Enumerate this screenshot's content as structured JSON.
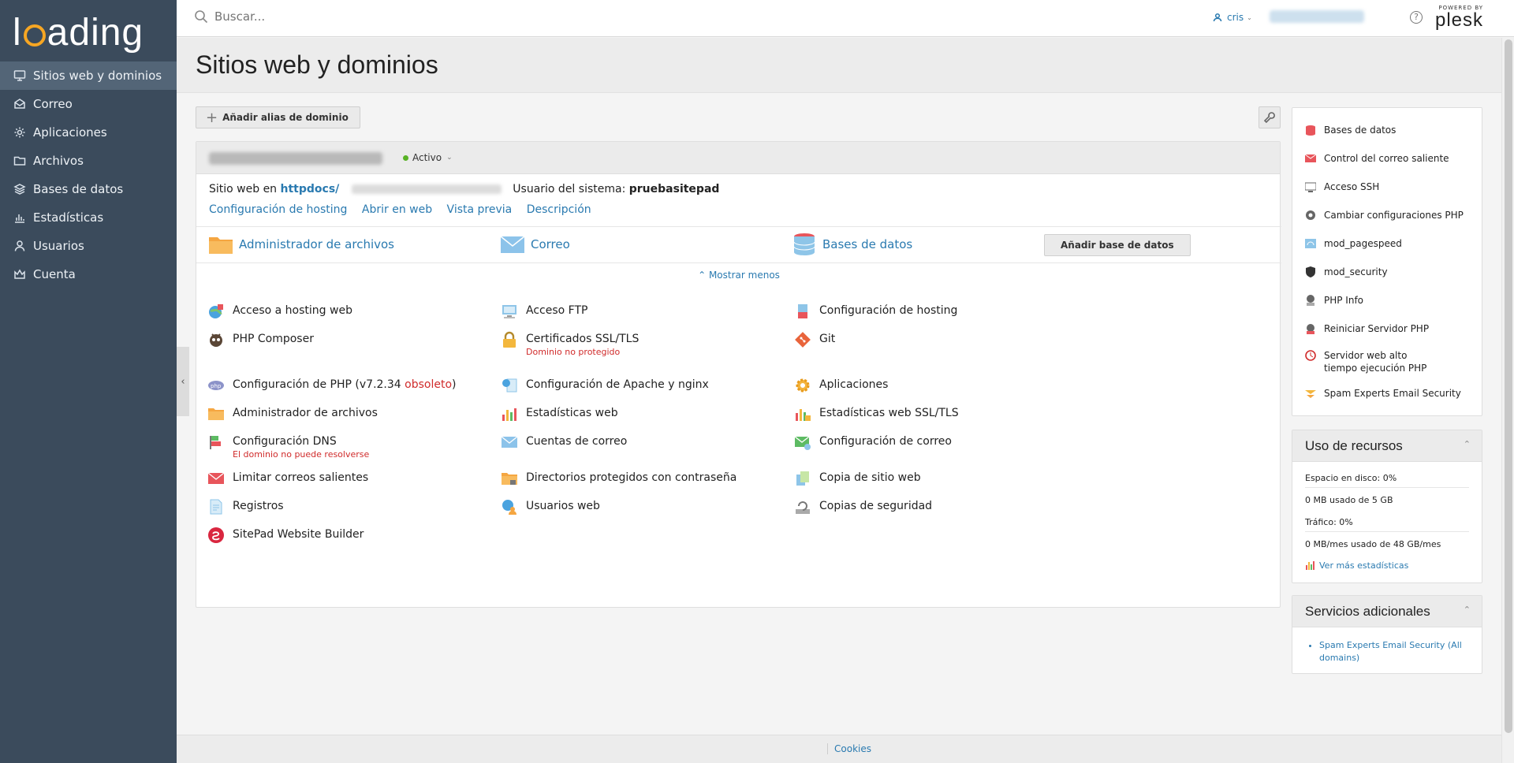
{
  "brand": {
    "logo_text_a": "l",
    "logo_text_b": "ading"
  },
  "sidebar": {
    "items": [
      {
        "label": "Sitios web y dominios",
        "icon": "monitor-icon",
        "active": true
      },
      {
        "label": "Correo",
        "icon": "envelope-icon"
      },
      {
        "label": "Aplicaciones",
        "icon": "gear-icon"
      },
      {
        "label": "Archivos",
        "icon": "folder-icon"
      },
      {
        "label": "Bases de datos",
        "icon": "layers-icon"
      },
      {
        "label": "Estadísticas",
        "icon": "bar-chart-icon"
      },
      {
        "label": "Usuarios",
        "icon": "user-icon"
      },
      {
        "label": "Cuenta",
        "icon": "crown-icon"
      }
    ]
  },
  "header": {
    "search_placeholder": "Buscar...",
    "user": "cris",
    "powered_by": "POWERED BY",
    "plesk": "plesk"
  },
  "page": {
    "title": "Sitios web y dominios"
  },
  "toolbar": {
    "add_alias": "Añadir alias de dominio"
  },
  "domain": {
    "status": "Activo",
    "site_prefix": "Sitio web en ",
    "docroot": "httpdocs/",
    "system_user_label": "Usuario del sistema: ",
    "system_user": "pruebasitepad",
    "links": [
      "Configuración de hosting",
      "Abrir en web",
      "Vista previa",
      "Descripción"
    ],
    "quick": {
      "files": "Administrador de archivos",
      "mail": "Correo",
      "databases": "Bases de datos",
      "add_db": "Añadir base de datos"
    },
    "show_less": "Mostrar menos"
  },
  "tools": {
    "web_hosting_access": "Acceso a hosting web",
    "ftp_access": "Acceso FTP",
    "hosting_settings": "Configuración de hosting",
    "php_composer": "PHP Composer",
    "ssl": "Certificados SSL/TLS",
    "ssl_warning": "Dominio no protegido",
    "git": "Git",
    "php_settings": "Configuración de PHP (v7.2.34 ",
    "php_obsolete": "obsoleto",
    "php_close": ")",
    "apache_nginx": "Configuración de Apache y nginx",
    "applications": "Aplicaciones",
    "file_manager": "Administrador de archivos",
    "web_stats": "Estadísticas web",
    "web_stats_ssl": "Estadísticas web SSL/TLS",
    "dns": "Configuración DNS",
    "dns_warning": "El dominio no puede resolverse",
    "mail_accounts": "Cuentas de correo",
    "mail_settings": "Configuración de correo",
    "limit_outgoing": "Limitar correos salientes",
    "protected_dirs": "Directorios protegidos con contraseña",
    "site_copy": "Copia de sitio web",
    "logs": "Registros",
    "web_users": "Usuarios web",
    "backups": "Copias de seguridad",
    "sitepad": "SitePad Website Builder"
  },
  "right_links": [
    "Bases de datos",
    "Control del correo saliente",
    "Acceso SSH",
    "Cambiar configuraciones PHP",
    "mod_pagespeed",
    "mod_security",
    "PHP Info",
    "Reiniciar Servidor PHP",
    "Servidor web alto tiempo ejecución PHP",
    "Spam Experts Email Security"
  ],
  "usage": {
    "title": "Uso de recursos",
    "disk_label": "Espacio en disco: 0%",
    "disk_value": "0 MB usado de 5 GB",
    "traffic_label": "Tráfico: 0%",
    "traffic_value": "0 MB/mes usado de 48 GB/mes",
    "more": "Ver más estadísticas"
  },
  "services": {
    "title": "Servicios adicionales",
    "items": [
      "Spam Experts Email Security (All domains)"
    ]
  },
  "footer": {
    "cookies": "Cookies"
  },
  "colors": {
    "sidebar": "#3b4b5c",
    "sidebar_active": "#536577",
    "link": "#2a7ab0",
    "warning": "#d02b2b",
    "status_active": "#58b224",
    "logo_accent": "#f6a623"
  }
}
